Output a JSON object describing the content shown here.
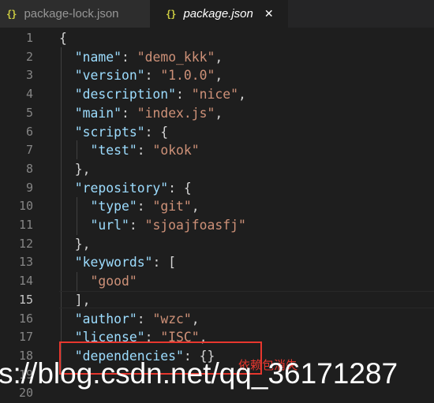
{
  "tabs": [
    {
      "name": "package-lock.json",
      "icon": "json-braces-icon",
      "active": false
    },
    {
      "name": "package.json",
      "icon": "json-braces-icon",
      "active": true
    }
  ],
  "close_glyph": "✕",
  "line_numbers": [
    "1",
    "2",
    "3",
    "4",
    "5",
    "6",
    "7",
    "8",
    "9",
    "10",
    "11",
    "12",
    "13",
    "14",
    "15",
    "16",
    "17",
    "18",
    "19",
    "20"
  ],
  "code": {
    "open_brace": "{",
    "name_key": "\"name\"",
    "name_val": "\"demo_kkk\"",
    "version_key": "\"version\"",
    "version_val": "\"1.0.0\"",
    "description_key": "\"description\"",
    "description_val": "\"nice\"",
    "main_key": "\"main\"",
    "main_val": "\"index.js\"",
    "scripts_key": "\"scripts\"",
    "test_key": "\"test\"",
    "test_val": "\"okok\"",
    "repository_key": "\"repository\"",
    "type_key": "\"type\"",
    "type_val": "\"git\"",
    "url_key": "\"url\"",
    "url_val": "\"sjoajfoasfj\"",
    "keywords_key": "\"keywords\"",
    "keyword_1": "\"good\"",
    "author_key": "\"author\"",
    "author_val": "\"wzc\"",
    "license_key": "\"license\"",
    "license_val": "\"ISC\"",
    "dependencies_key": "\"dependencies\"",
    "dependencies_val": "{}"
  },
  "annotation": "依赖包消失",
  "watermark": "s://blog.csdn.net/qq_36171287",
  "colors": {
    "background": "#1e1e1e",
    "key": "#9cdcfe",
    "string": "#ce9178",
    "punctuation": "#d4d4d4",
    "annotation_red": "#e8372e",
    "json_icon": "#cbcb41"
  }
}
